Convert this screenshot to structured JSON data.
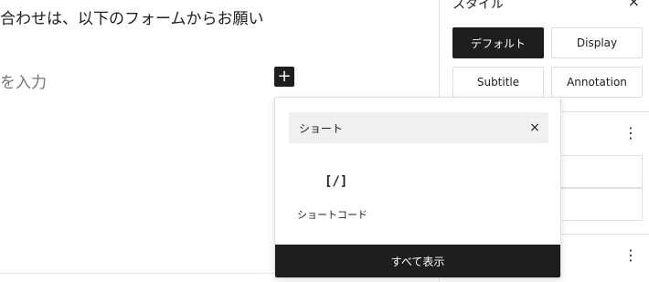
{
  "editor": {
    "paragraph_text": "合わせは、以下のフォームからお願い",
    "placeholder_text": "を入力",
    "inserter_symbol": "+"
  },
  "sidebar": {
    "title": "スタイル",
    "close_symbol": "×",
    "styles": [
      {
        "label": "デフォルト",
        "active": true
      },
      {
        "label": "Display",
        "active": false
      },
      {
        "label": "Subtitle",
        "active": false
      },
      {
        "label": "Annotation",
        "active": false
      }
    ],
    "more_symbol": "⋮"
  },
  "inserter": {
    "search_value": "ショート",
    "clear_symbol": "×",
    "results": [
      {
        "icon": "[/]",
        "label": "ショートコード"
      }
    ],
    "browse_all_label": "すべて表示"
  },
  "colors": {
    "dark": "#1e1e1e",
    "search_bg": "#f0f0f0",
    "border": "#e0e0e0"
  },
  "icons": {
    "inserter": "plus-icon",
    "close": "close-icon",
    "more": "more-vertical-icon",
    "shortcode": "shortcode-icon"
  }
}
